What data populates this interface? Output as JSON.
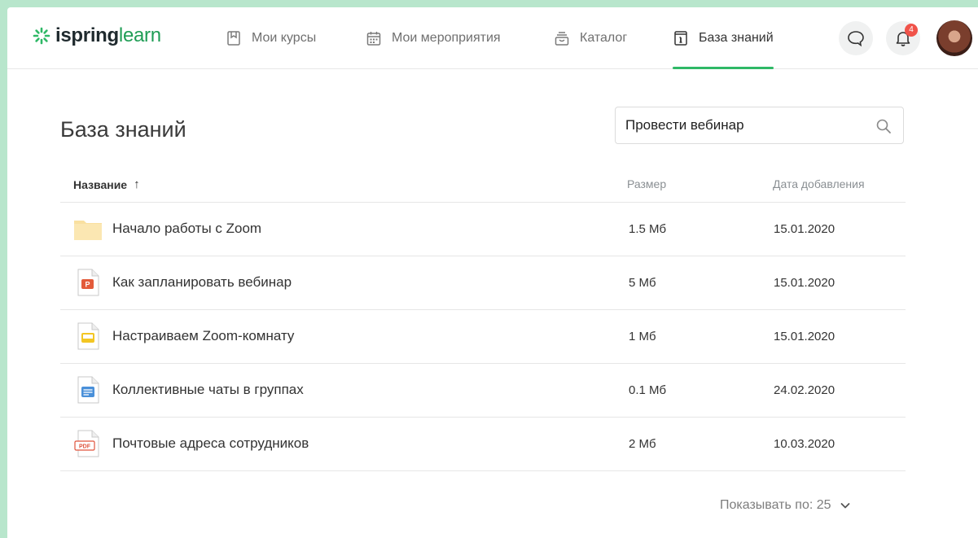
{
  "brand": {
    "part1": "ispring",
    "part2": "learn"
  },
  "nav": [
    {
      "label": "Мои курсы",
      "icon": "bookmark-icon"
    },
    {
      "label": "Мои мероприятия",
      "icon": "calendar-icon"
    },
    {
      "label": "Каталог",
      "icon": "catalog-icon"
    },
    {
      "label": "База знаний",
      "icon": "info-book-icon",
      "active": true
    }
  ],
  "notifications": {
    "count": "4"
  },
  "page": {
    "title": "База знаний"
  },
  "search": {
    "value": "Провести вебинар"
  },
  "table": {
    "headers": {
      "name": "Название",
      "size": "Размер",
      "date": "Дата добавления"
    },
    "sort_arrow": "↑",
    "rows": [
      {
        "name": "Начало работы с Zoom",
        "size": "1.5 Мб",
        "date": "15.01.2020",
        "type": "folder"
      },
      {
        "name": "Как запланировать вебинар",
        "size": "5 Мб",
        "date": "15.01.2020",
        "type": "ppt"
      },
      {
        "name": "Настраиваем Zoom-комнату",
        "size": "1 Мб",
        "date": "15.01.2020",
        "type": "slides"
      },
      {
        "name": "Коллективные чаты в группах",
        "size": "0.1 Мб",
        "date": "24.02.2020",
        "type": "doc"
      },
      {
        "name": "Почтовые адреса сотрудников",
        "size": "2 Мб",
        "date": "10.03.2020",
        "type": "pdf"
      }
    ]
  },
  "pagination": {
    "label": "Показывать по: 25"
  },
  "colors": {
    "accent": "#2fb866",
    "badge": "#f0534a",
    "folder": "#fbe3a0"
  }
}
